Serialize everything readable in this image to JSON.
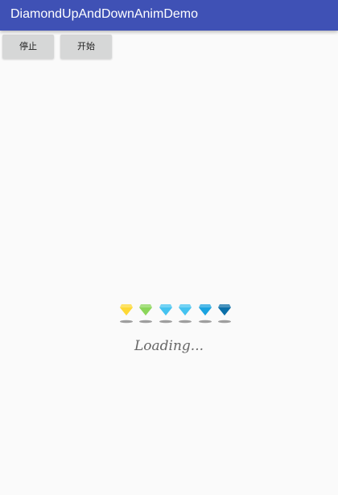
{
  "app_bar": {
    "title": "DiamondUpAndDownAnimDemo",
    "color": "#3f51b5"
  },
  "buttons": {
    "stop_label": "停止",
    "start_label": "开始"
  },
  "loader": {
    "diamonds": [
      {
        "icon": "diamond-icon",
        "color": "#fdd835"
      },
      {
        "icon": "diamond-icon",
        "color": "#8bd65a"
      },
      {
        "icon": "diamond-icon",
        "color": "#45c3f0"
      },
      {
        "icon": "diamond-icon",
        "color": "#45c3f0"
      },
      {
        "icon": "diamond-icon",
        "color": "#1aa3e0"
      },
      {
        "icon": "diamond-icon",
        "color": "#0b6fa8"
      }
    ],
    "shadow_color": "#9e9e9e",
    "loading_text": "Loading..."
  }
}
